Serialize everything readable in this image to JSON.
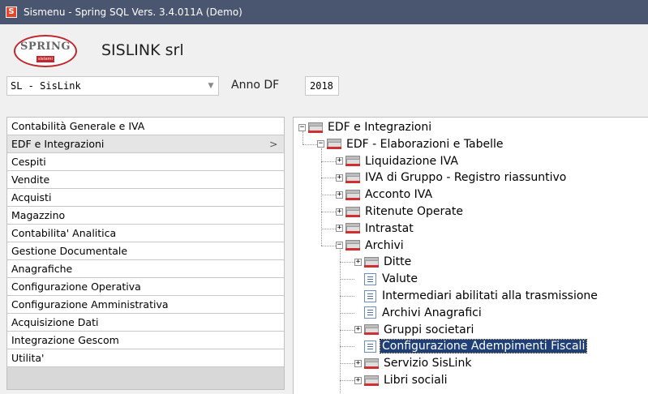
{
  "window": {
    "title": "Sismenu - Spring SQL Vers. 3.4.011A (Demo)",
    "icon": "spring-app-icon"
  },
  "header": {
    "logo_text": "SPRING",
    "logo_sub": "sistemi",
    "company": "SISLINK srl"
  },
  "selector": {
    "company_value": "SL - SisLink",
    "anno_label": "Anno DF",
    "anno_value": "2018"
  },
  "menu": {
    "items": [
      {
        "label": "Contabilità Generale e IVA",
        "selected": false
      },
      {
        "label": "EDF e Integrazioni",
        "selected": true
      },
      {
        "label": "Cespiti",
        "selected": false
      },
      {
        "label": "Vendite",
        "selected": false
      },
      {
        "label": "Acquisti",
        "selected": false
      },
      {
        "label": "Magazzino",
        "selected": false
      },
      {
        "label": "Contabilita' Analitica",
        "selected": false
      },
      {
        "label": "Gestione Documentale",
        "selected": false
      },
      {
        "label": "Anagrafiche",
        "selected": false
      },
      {
        "label": "Configurazione Operativa",
        "selected": false
      },
      {
        "label": "Configurazione Amministrativa",
        "selected": false
      },
      {
        "label": "Acquisizione Dati",
        "selected": false
      },
      {
        "label": "Integrazione Gescom",
        "selected": false
      },
      {
        "label": "Utilita'",
        "selected": false
      }
    ],
    "chevron": ">"
  },
  "tree": {
    "nodes": [
      {
        "label": "EDF e Integrazioni",
        "level": 0,
        "type": "folder",
        "state": "expanded"
      },
      {
        "label": "EDF - Elaborazioni e Tabelle",
        "level": 1,
        "type": "folder",
        "state": "expanded"
      },
      {
        "label": "Liquidazione IVA",
        "level": 2,
        "type": "folder",
        "state": "collapsed"
      },
      {
        "label": "IVA di Gruppo - Registro riassuntivo",
        "level": 2,
        "type": "folder",
        "state": "collapsed"
      },
      {
        "label": "Acconto IVA",
        "level": 2,
        "type": "folder",
        "state": "collapsed"
      },
      {
        "label": "Ritenute Operate",
        "level": 2,
        "type": "folder",
        "state": "collapsed"
      },
      {
        "label": "Intrastat",
        "level": 2,
        "type": "folder",
        "state": "collapsed"
      },
      {
        "label": "Archivi",
        "level": 2,
        "type": "folder",
        "state": "expanded"
      },
      {
        "label": "Ditte",
        "level": 3,
        "type": "folder",
        "state": "collapsed"
      },
      {
        "label": "Valute",
        "level": 3,
        "type": "doc",
        "state": "leaf"
      },
      {
        "label": "Intermediari abilitati alla trasmissione",
        "level": 3,
        "type": "doc",
        "state": "leaf"
      },
      {
        "label": "Archivi Anagrafici",
        "level": 3,
        "type": "doc",
        "state": "leaf"
      },
      {
        "label": "Gruppi societari",
        "level": 3,
        "type": "folder",
        "state": "collapsed"
      },
      {
        "label": "Configurazione Adempimenti Fiscali",
        "level": 3,
        "type": "doc",
        "state": "leaf",
        "highlighted": true
      },
      {
        "label": "Servizio SisLink",
        "level": 3,
        "type": "folder",
        "state": "collapsed"
      },
      {
        "label": "Libri sociali",
        "level": 3,
        "type": "folder",
        "state": "collapsed"
      }
    ]
  }
}
